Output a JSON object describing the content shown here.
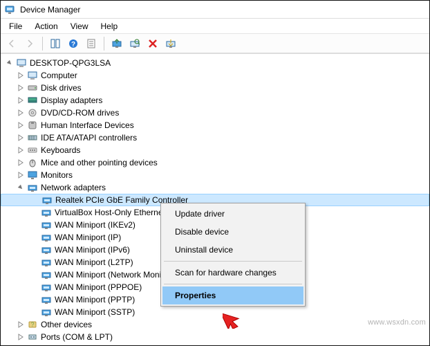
{
  "window": {
    "title": "Device Manager"
  },
  "menu": {
    "file": "File",
    "action": "Action",
    "view": "View",
    "help": "Help"
  },
  "tree": {
    "root": "DESKTOP-QPG3LSA",
    "nodes": {
      "computer": "Computer",
      "disk_drives": "Disk drives",
      "display_adapters": "Display adapters",
      "dvd": "DVD/CD-ROM drives",
      "hid": "Human Interface Devices",
      "ide": "IDE ATA/ATAPI controllers",
      "keyboards": "Keyboards",
      "mice": "Mice and other pointing devices",
      "monitors": "Monitors",
      "network": "Network adapters",
      "other": "Other devices",
      "ports": "Ports (COM & LPT)"
    },
    "network_children": [
      "Realtek PCIe GbE Family Controller",
      "VirtualBox Host-Only Ethernet Adapter",
      "WAN Miniport (IKEv2)",
      "WAN Miniport (IP)",
      "WAN Miniport (IPv6)",
      "WAN Miniport (L2TP)",
      "WAN Miniport (Network Monitor)",
      "WAN Miniport (PPPOE)",
      "WAN Miniport (PPTP)",
      "WAN Miniport (SSTP)"
    ]
  },
  "context_menu": {
    "update_driver": "Update driver",
    "disable_device": "Disable device",
    "uninstall_device": "Uninstall device",
    "scan_hw": "Scan for hardware changes",
    "properties": "Properties"
  },
  "watermark": "www.wsxdn.com"
}
